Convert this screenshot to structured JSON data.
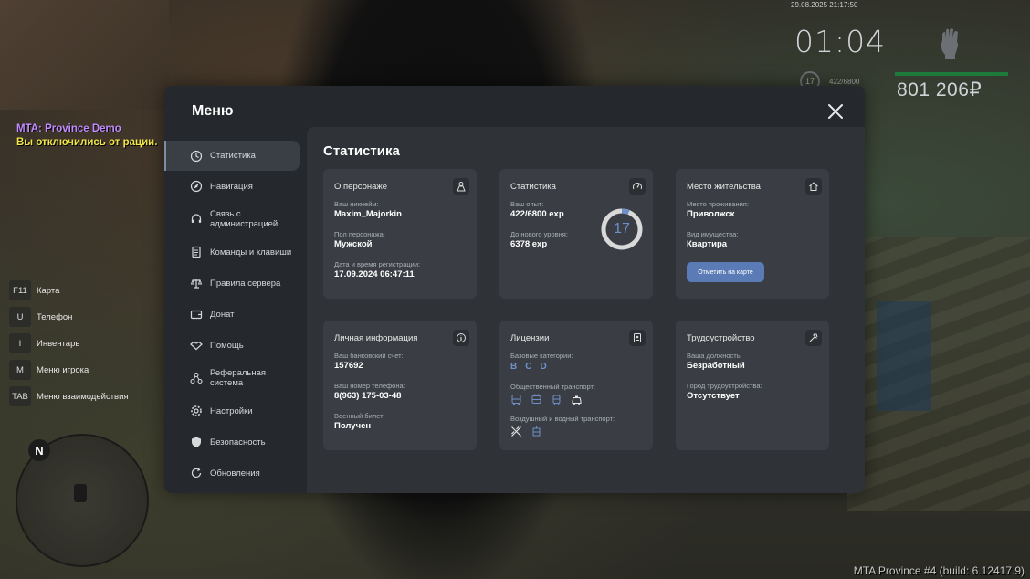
{
  "hud": {
    "datetime": "29.08.2025 21:17:50",
    "clock": "01:04",
    "level": "17",
    "exp": "422/6800",
    "money": "801 206₽",
    "build": "MTA Province #4 (build: 6.12417.9)"
  },
  "chat": {
    "line1": "MTA: Province Demo",
    "line2": "Вы отключились от рации."
  },
  "keybinds": [
    {
      "key": "F11",
      "label": "Карта"
    },
    {
      "key": "U",
      "label": "Телефон"
    },
    {
      "key": "I",
      "label": "Инвентарь"
    },
    {
      "key": "M",
      "label": "Меню игрока"
    },
    {
      "key": "TAB",
      "label": "Меню взаимодействия"
    }
  ],
  "minimap": {
    "north": "N"
  },
  "menu": {
    "title": "Меню",
    "sidebar": [
      {
        "label": "Статистика",
        "icon": "clock-icon"
      },
      {
        "label": "Навигация",
        "icon": "compass-icon"
      },
      {
        "label": "Связь с администрацией",
        "icon": "headset-icon"
      },
      {
        "label": "Команды и клавиши",
        "icon": "document-icon"
      },
      {
        "label": "Правила сервера",
        "icon": "scales-icon"
      },
      {
        "label": "Донат",
        "icon": "wallet-icon"
      },
      {
        "label": "Помощь",
        "icon": "handshake-icon"
      },
      {
        "label": "Реферальная система",
        "icon": "network-icon"
      },
      {
        "label": "Настройки",
        "icon": "gear-icon"
      },
      {
        "label": "Безопасность",
        "icon": "shield-icon"
      },
      {
        "label": "Обновления",
        "icon": "refresh-icon"
      }
    ],
    "content_title": "Статистика",
    "cards": {
      "character": {
        "title": "О персонаже",
        "nick_label": "Ваш никнейм:",
        "nick": "Maxim_Majorkin",
        "gender_label": "Пол персонажа:",
        "gender": "Мужской",
        "reg_label": "Дата и время регистрации:",
        "reg": "17.09.2024 06:47:11"
      },
      "stats": {
        "title": "Статистика",
        "exp_label": "Ваш опыт:",
        "exp": "422/6800 exp",
        "next_label": "До нового уровня:",
        "next": "6378 exp",
        "level": "17",
        "progress": 0.062
      },
      "residence": {
        "title": "Место жительства",
        "place_label": "Место проживания:",
        "place": "Приволжск",
        "type_label": "Вид имущества:",
        "type": "Квартира",
        "button": "Отметить на карте"
      },
      "personal": {
        "title": "Личная информация",
        "bank_label": "Ваш банковский счет:",
        "bank": "157692",
        "phone_label": "Ваш номер телефона:",
        "phone": "8(963) 175-03-48",
        "military_label": "Военный билет:",
        "military": "Получен"
      },
      "licenses": {
        "title": "Лицензии",
        "base_label": "Базовые категории:",
        "base": [
          "B",
          "C",
          "D"
        ],
        "public_label": "Общественный транспорт:",
        "air_label": "Воздушный и водный транспорт:"
      },
      "job": {
        "title": "Трудоустройство",
        "position_label": "Ваша должность:",
        "position": "Безработный",
        "city_label": "Город трудоустройства:",
        "city": "Отсутствует"
      }
    }
  }
}
